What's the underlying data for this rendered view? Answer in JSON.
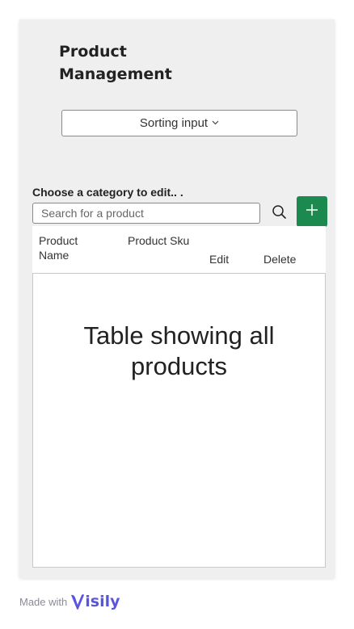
{
  "header": {
    "title": "Product Management"
  },
  "sort": {
    "label": "Sorting input"
  },
  "category": {
    "label": "Choose a category to edit.. ."
  },
  "search": {
    "placeholder": "Search for a product"
  },
  "table": {
    "columns": [
      "Product Name",
      "Product Sku",
      "Edit",
      "Delete"
    ],
    "placeholder": "Table showing all products"
  },
  "footer": {
    "made_with": "Made with",
    "brand": "isily"
  },
  "colors": {
    "accent": "#1c8a4f",
    "brand": "#5a55e0",
    "card": "#efefef"
  }
}
